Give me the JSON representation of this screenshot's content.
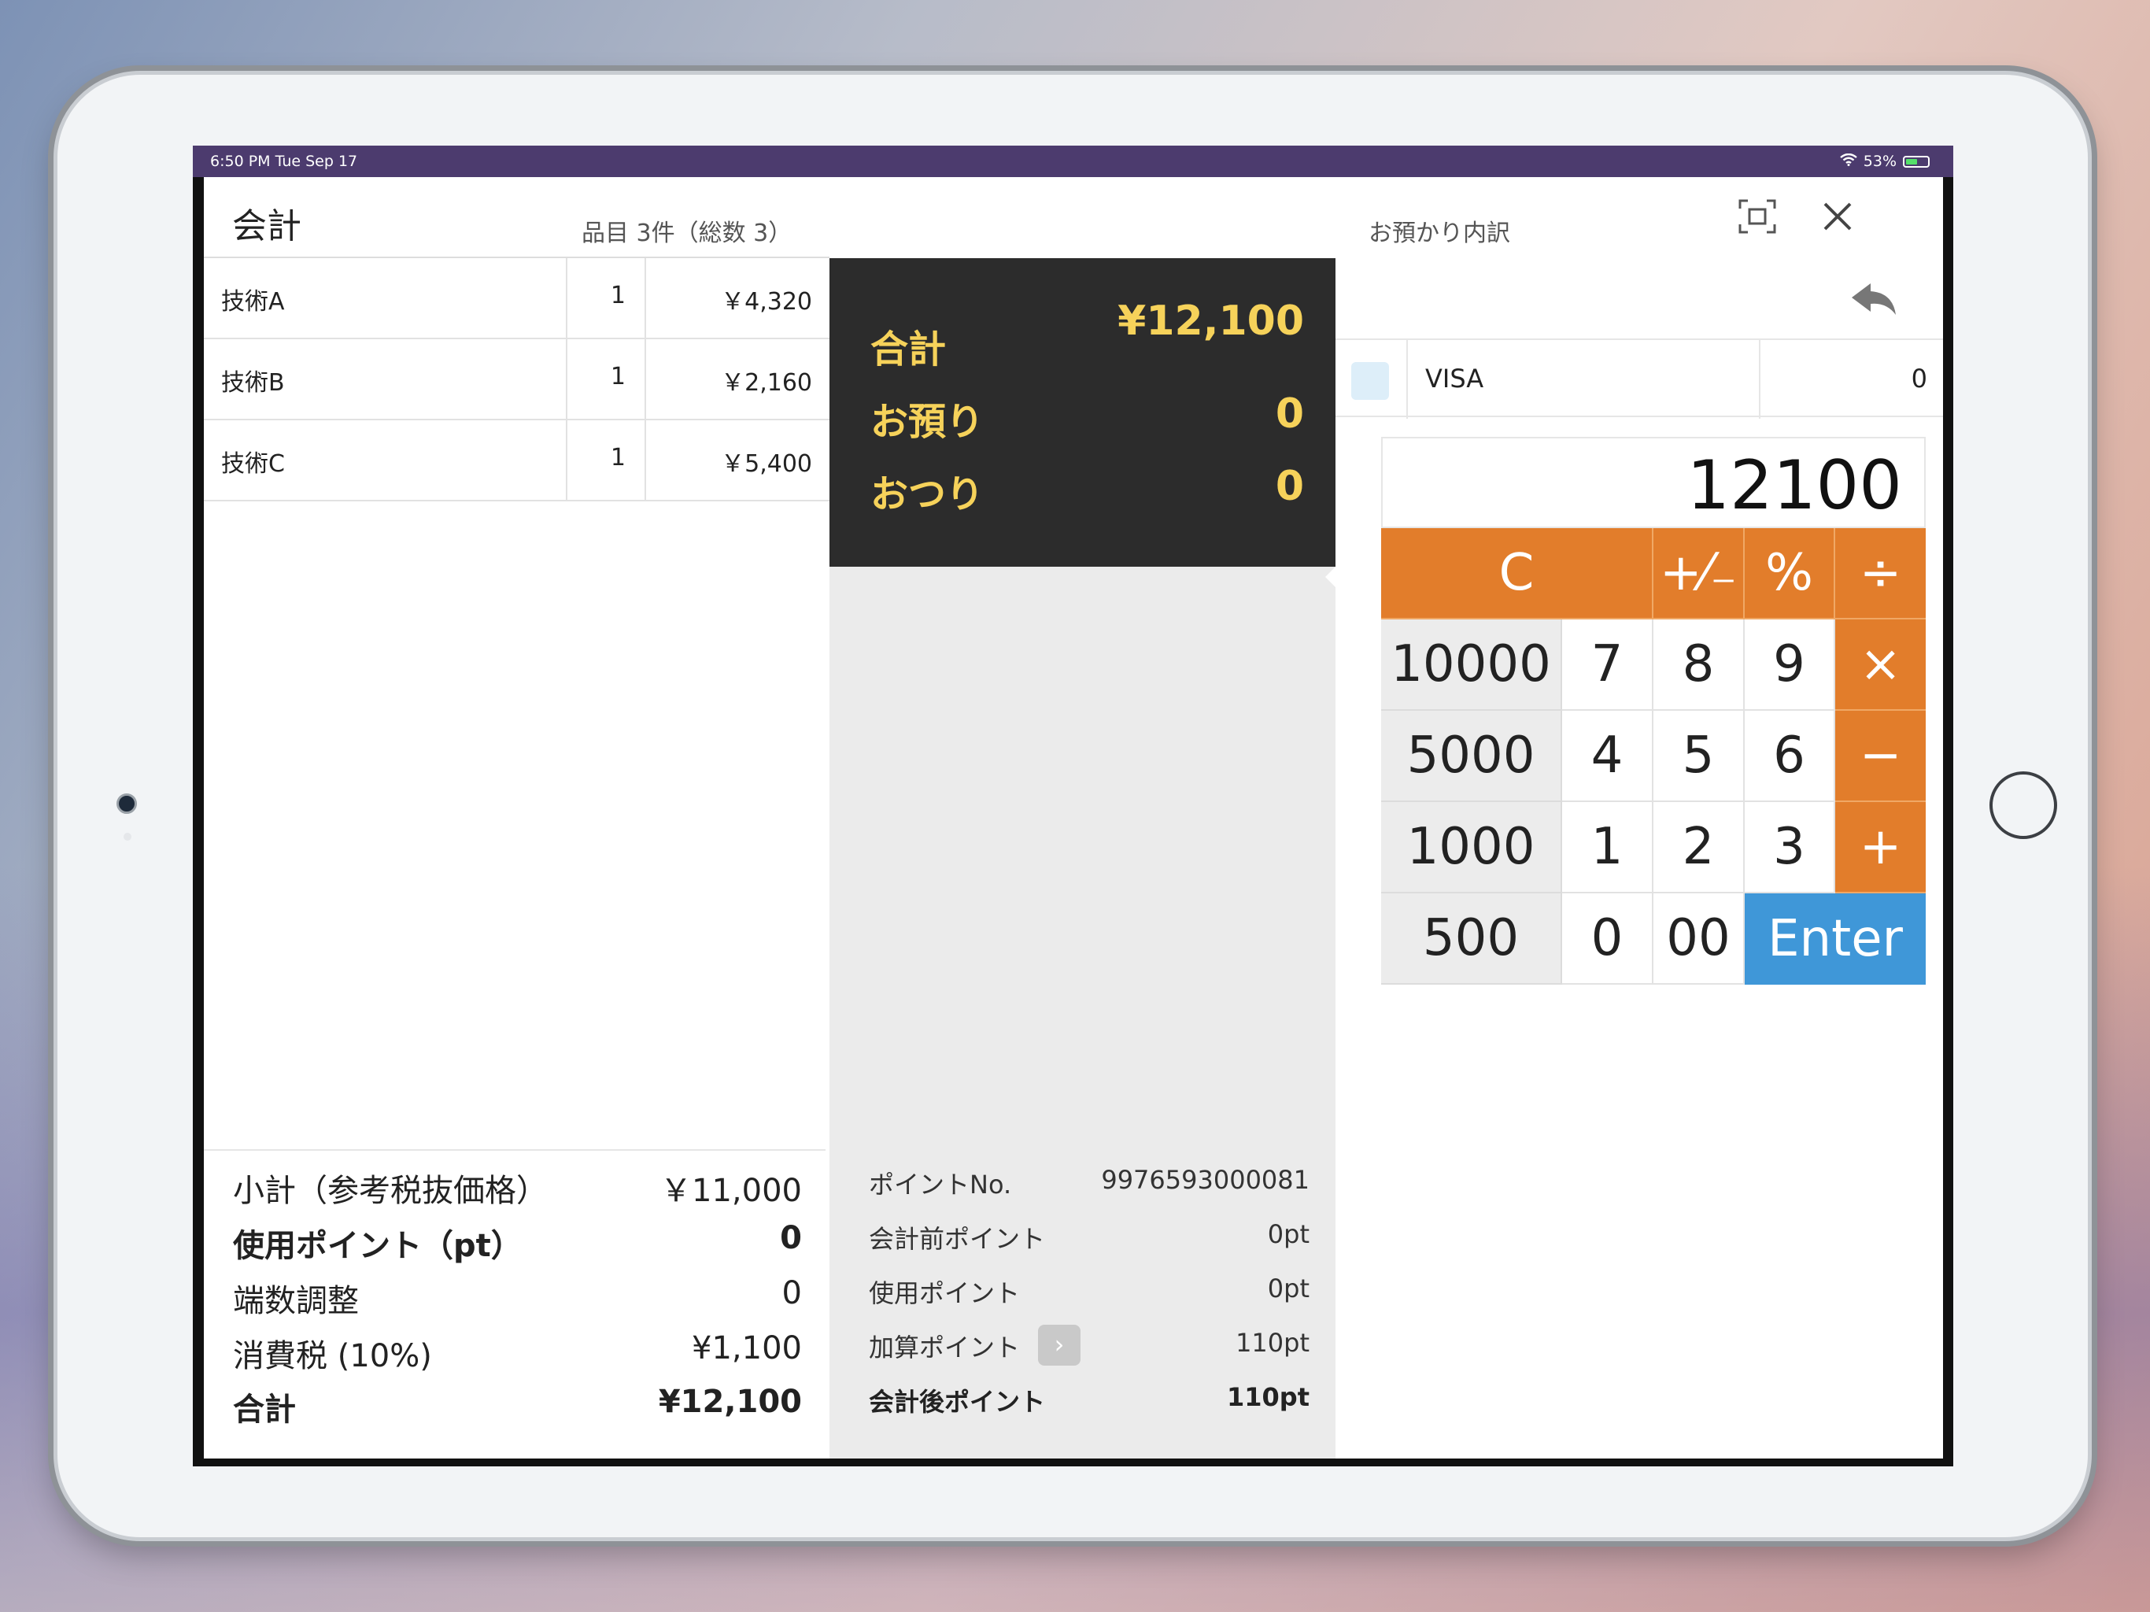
{
  "status_bar": {
    "time": "6:50 PM  Tue Sep 17",
    "battery": "53%",
    "battery_level": 0.53
  },
  "header": {
    "title": "会計",
    "items_summary": "品目 3件（総数 3）",
    "azukari_title": "お預かり内訳"
  },
  "items": [
    {
      "name": "技術A",
      "qty": "1",
      "price": "￥4,320"
    },
    {
      "name": "技術B",
      "qty": "1",
      "price": "￥2,160"
    },
    {
      "name": "技術C",
      "qty": "1",
      "price": "￥5,400"
    }
  ],
  "summary": {
    "subtotal_label": "小計（参考税抜価格）",
    "subtotal_value": "￥11,000",
    "used_points_label": "使用ポイント（pt）",
    "used_points_value": "0",
    "rounding_label": "端数調整",
    "rounding_value": "0",
    "tax_label": "消費税 (10%)",
    "tax_value": "¥1,100",
    "total_label": "合計",
    "total_value": "¥12,100"
  },
  "totals": {
    "total_label": "合計",
    "total_value": "¥12,100",
    "deposit_label": "お預り",
    "deposit_value": "0",
    "change_label": "おつり",
    "change_value": "0"
  },
  "points": {
    "no_label": "ポイントNo.",
    "no_value": "9976593000081",
    "before_label": "会計前ポイント",
    "before_value": "0pt",
    "used_label": "使用ポイント",
    "used_value": "0pt",
    "added_label": "加算ポイント",
    "added_value": "110pt",
    "after_label": "会計後ポイント",
    "after_value": "110pt",
    "chevron": "›"
  },
  "payment": {
    "method": "VISA",
    "amount": "0"
  },
  "calculator": {
    "display": "12100",
    "keys": {
      "clear": "C",
      "plusminus": "+⁄₋",
      "percent": "%",
      "divide": "÷",
      "multiply": "×",
      "minus": "−",
      "plus": "+",
      "enter": "Enter",
      "p10000": "10000",
      "p5000": "5000",
      "p1000": "1000",
      "p500": "500",
      "n7": "7",
      "n8": "8",
      "n9": "9",
      "n4": "4",
      "n5": "5",
      "n6": "6",
      "n1": "1",
      "n2": "2",
      "n3": "3",
      "n0": "0",
      "n00": "00"
    }
  },
  "colors": {
    "accent_orange": "#e27d2b",
    "enter_blue": "#3f97d8",
    "total_yellow": "#f6d25a",
    "status_purple": "#4c3b6e"
  }
}
